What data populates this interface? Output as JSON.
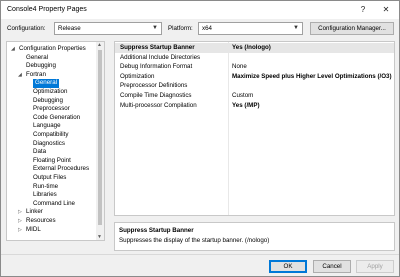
{
  "window": {
    "title": "Console4 Property Pages",
    "help_glyph": "?",
    "close_glyph": "✕"
  },
  "config_bar": {
    "configuration_label": "Configuration:",
    "configuration_value": "Release",
    "platform_label": "Platform:",
    "platform_value": "x64",
    "manager_button": "Configuration Manager..."
  },
  "tree": {
    "items": [
      {
        "label": "Configuration Properties",
        "expanded": true,
        "selected": false
      },
      {
        "label": "General",
        "expanded": null,
        "selected": false
      },
      {
        "label": "Debugging",
        "expanded": null,
        "selected": false
      },
      {
        "label": "Fortran",
        "expanded": true,
        "selected": false
      },
      {
        "label": "General",
        "expanded": null,
        "selected": true
      },
      {
        "label": "Optimization",
        "expanded": null,
        "selected": false
      },
      {
        "label": "Debugging",
        "expanded": null,
        "selected": false
      },
      {
        "label": "Preprocessor",
        "expanded": null,
        "selected": false
      },
      {
        "label": "Code Generation",
        "expanded": null,
        "selected": false
      },
      {
        "label": "Language",
        "expanded": null,
        "selected": false
      },
      {
        "label": "Compatibility",
        "expanded": null,
        "selected": false
      },
      {
        "label": "Diagnostics",
        "expanded": null,
        "selected": false
      },
      {
        "label": "Data",
        "expanded": null,
        "selected": false
      },
      {
        "label": "Floating Point",
        "expanded": null,
        "selected": false
      },
      {
        "label": "External Procedures",
        "expanded": null,
        "selected": false
      },
      {
        "label": "Output Files",
        "expanded": null,
        "selected": false
      },
      {
        "label": "Run-time",
        "expanded": null,
        "selected": false
      },
      {
        "label": "Libraries",
        "expanded": null,
        "selected": false
      },
      {
        "label": "Command Line",
        "expanded": null,
        "selected": false
      },
      {
        "label": "Linker",
        "expanded": false,
        "selected": false
      },
      {
        "label": "Resources",
        "expanded": false,
        "selected": false
      },
      {
        "label": "MIDL",
        "expanded": false,
        "selected": false
      }
    ]
  },
  "properties": [
    {
      "name": "Suppress Startup Banner",
      "value": "Yes (/nologo)",
      "bold": true,
      "selected": true
    },
    {
      "name": "Additional Include Directories",
      "value": "",
      "bold": false,
      "selected": false
    },
    {
      "name": "Debug Information Format",
      "value": "None",
      "bold": false,
      "selected": false
    },
    {
      "name": "Optimization",
      "value": "Maximize Speed plus Higher Level Optimizations (/O3)",
      "bold": true,
      "selected": false
    },
    {
      "name": "Preprocessor Definitions",
      "value": "",
      "bold": false,
      "selected": false
    },
    {
      "name": "Compile Time Diagnostics",
      "value": "Custom",
      "bold": false,
      "selected": false
    },
    {
      "name": "Multi-processor Compilation",
      "value": "Yes (/MP)",
      "bold": true,
      "selected": false
    }
  ],
  "description": {
    "title": "Suppress Startup Banner",
    "text": "Suppresses the display of the startup banner. (/nologo)"
  },
  "buttons": {
    "ok": "OK",
    "cancel": "Cancel",
    "apply": "Apply"
  }
}
